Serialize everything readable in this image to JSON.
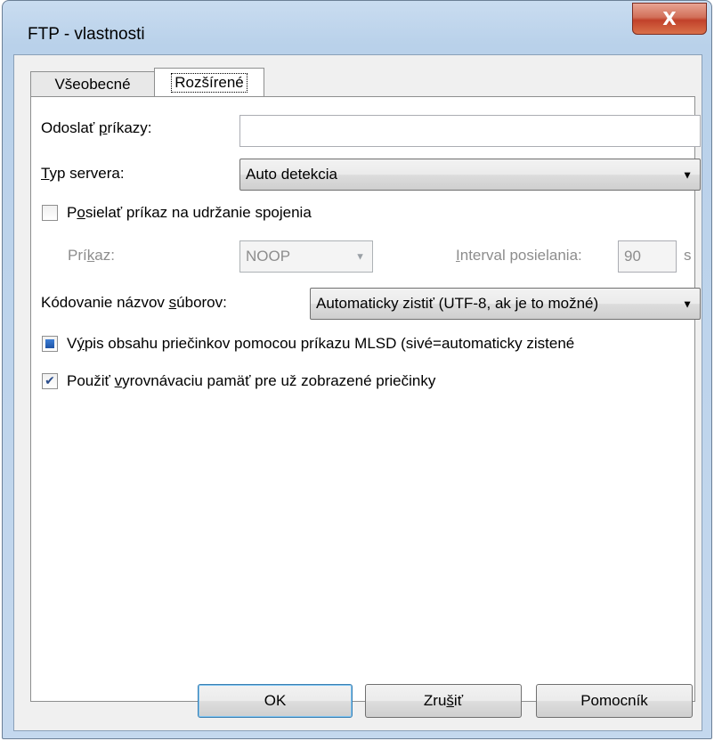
{
  "window": {
    "title": "FTP - vlastnosti",
    "close_glyph": "X"
  },
  "tabs": [
    {
      "label": "Všeobecné",
      "selected": false
    },
    {
      "label": "Rozšírené",
      "selected": true
    }
  ],
  "form": {
    "send_commands": {
      "label_pre": "Odoslať ",
      "label_u": "p",
      "label_post": "ríkazy:",
      "value": ""
    },
    "server_type": {
      "label_u": "T",
      "label_post": "yp servera:",
      "value": "Auto detekcia"
    },
    "keepalive": {
      "label_pre": "P",
      "label_u": "o",
      "label_post": "sielať príkaz na udržanie spojenia",
      "checked": false,
      "command_label_pre": "Prí",
      "command_label_u": "k",
      "command_label_post": "az:",
      "command_value": "NOOP",
      "interval_label_u": "I",
      "interval_label_post": "nterval posielania:",
      "interval_value": "90",
      "interval_unit": "s"
    },
    "encoding": {
      "label_pre": "Kódovanie názvov ",
      "label_u": "s",
      "label_post": "úborov:",
      "value": "Automaticky zistiť (UTF-8, ak je to možné)"
    },
    "mlsd": {
      "label_pre": "V",
      "label_u": "ý",
      "label_post": "pis obsahu priečinkov pomocou príkazu MLSD (sivé=automaticky zistené",
      "state": "indeterminate"
    },
    "cache": {
      "label_pre": "Použiť ",
      "label_u": "v",
      "label_post": "yrovnávaciu pamäť pre už zobrazené priečinky",
      "checked": true
    }
  },
  "buttons": {
    "ok": "OK",
    "cancel_pre": "Zru",
    "cancel_u": "š",
    "cancel_post": "iť",
    "help": "Pomocník"
  },
  "colors": {
    "titlebar": "#b9d1ea",
    "close_button": "#c1412a",
    "disabled_text": "#8d8d8d"
  }
}
